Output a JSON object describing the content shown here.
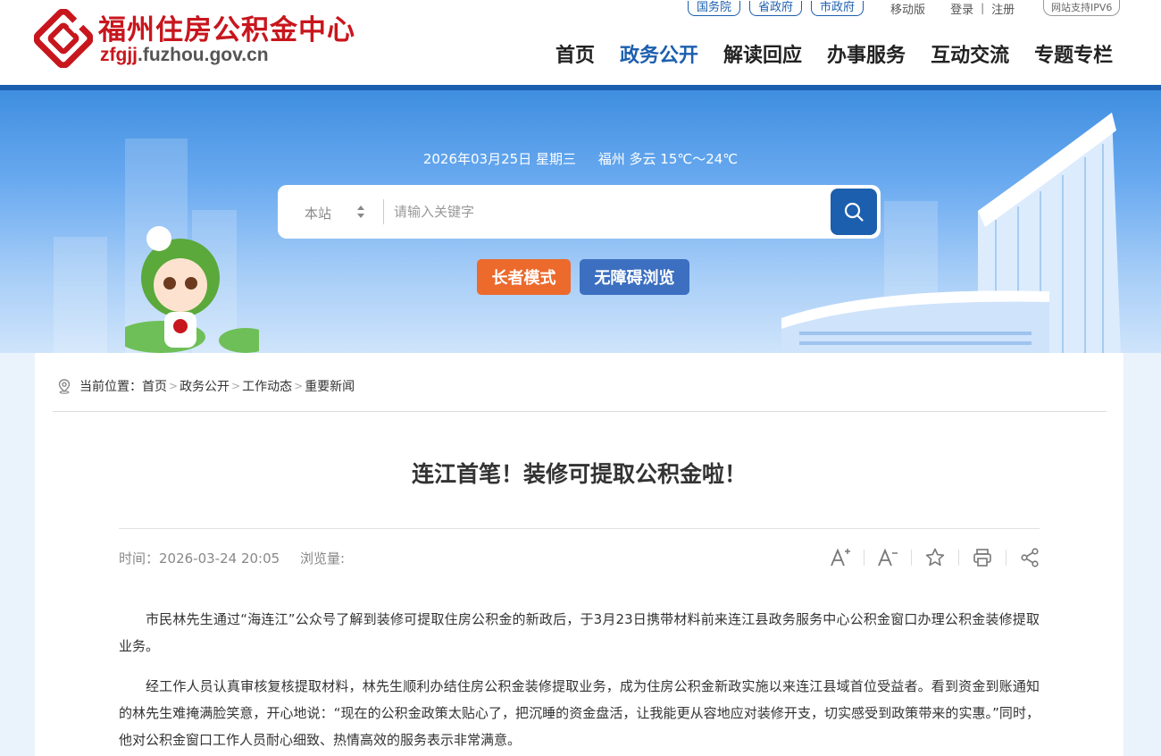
{
  "header": {
    "logo_title": "福州住房公积金中心",
    "logo_url_highlight": "zfgjj",
    "logo_url_rest": ".fuzhou.gov.cn",
    "top_pills": [
      "国务院",
      "省政府",
      "市政府"
    ],
    "mobile": "移动版",
    "login": "登录",
    "divider": "|",
    "register": "注册",
    "ipv6": "网站支持IPV6",
    "nav": [
      "首页",
      "政务公开",
      "解读回应",
      "办事服务",
      "互动交流",
      "专题专栏"
    ],
    "active_nav_index": 1
  },
  "banner": {
    "date": "2026年03月25日 星期三",
    "weather": "福州 多云 15℃～24℃",
    "search_scope": "本站",
    "search_placeholder": "请输入关键字",
    "elder_mode": "长者模式",
    "accessible": "无障碍浏览"
  },
  "breadcrumb": {
    "label": "当前位置：",
    "items": [
      "首页",
      "政务公开",
      "工作动态",
      "重要新闻"
    ],
    "separator": ">"
  },
  "article": {
    "title": "连江首笔！装修可提取公积金啦！",
    "time": "时间：2026-03-24 20:05",
    "views": "浏览量:",
    "paragraphs": [
      "市民林先生通过“海连江”公众号了解到装修可提取住房公积金的新政后，于3月23日携带材料前来连江县政务服务中心公积金窗口办理公积金装修提取业务。",
      "经工作人员认真审核复核提取材料，林先生顺利办结住房公积金装修提取业务，成为住房公积金新政实施以来连江县域首位受益者。看到资金到账通知的林先生难掩满脸笑意，开心地说：“现在的公积金政策太贴心了，把沉睡的资金盘活，让我能更从容地应对装修开支，切实感受到政策带来的实惠。”同时，他对公积金窗口工作人员耐心细致、热情高效的服务表示非常满意。"
    ]
  },
  "colors": {
    "brand_red": "#c8161d",
    "brand_blue": "#1c5fae",
    "elder_orange": "#ec6a2c",
    "accessible_blue": "#3c6fc0"
  }
}
